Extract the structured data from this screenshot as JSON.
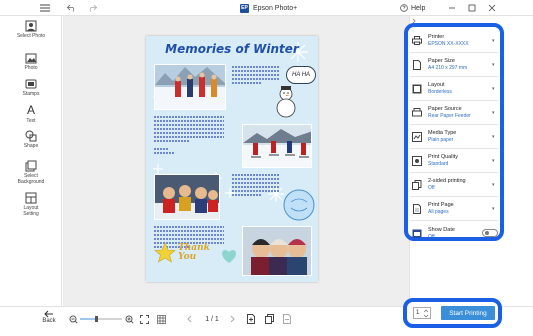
{
  "app": {
    "title": "Epson Photo+",
    "logo_text": "EP",
    "help_label": "Help"
  },
  "left_tools": [
    {
      "label": "Select Photo"
    },
    {
      "label": "Photo"
    },
    {
      "label": "Stamps"
    },
    {
      "label": "Text"
    },
    {
      "label": "Shape"
    },
    {
      "label": "Select Background"
    },
    {
      "label": "Layout Setting"
    }
  ],
  "back_label": "Back",
  "page": {
    "title": "Memories of Winter",
    "stamp_haha": "HA HA",
    "stamp_thank": "Thank You"
  },
  "bottom": {
    "page_indicator": "1 / 1"
  },
  "settings": [
    {
      "label": "Printer",
      "value": "EPSON XX-XXXX"
    },
    {
      "label": "Paper Size",
      "value": "A4 210 x 297 mm"
    },
    {
      "label": "Layout",
      "value": "Borderless"
    },
    {
      "label": "Paper Source",
      "value": "Rear Paper Feeder"
    },
    {
      "label": "Media Type",
      "value": "Plain paper"
    },
    {
      "label": "Print Quality",
      "value": "Standard"
    },
    {
      "label": "2-sided printing",
      "value": "Off"
    },
    {
      "label": "Print Page",
      "value": "All pages"
    },
    {
      "label": "Show Date",
      "value": "Off"
    }
  ],
  "print": {
    "copies": "1",
    "button_label": "Start Printing"
  },
  "colors": {
    "accent": "#1a5fe6",
    "button": "#3b8fd9",
    "page_bg": "#d7ecf7"
  }
}
